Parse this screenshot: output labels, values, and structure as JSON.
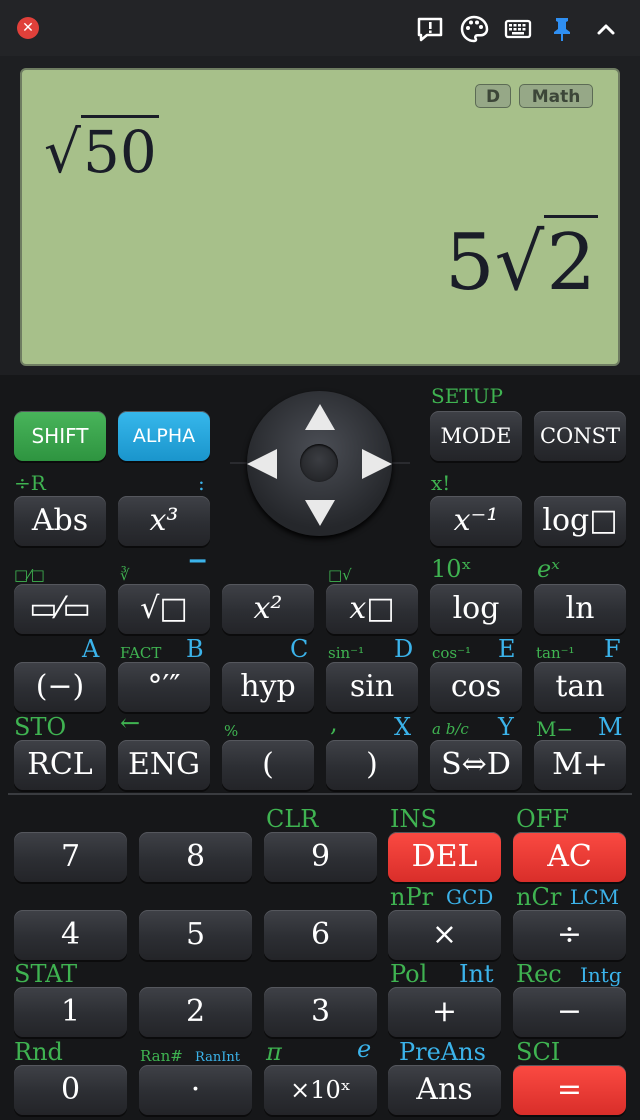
{
  "toolbar": {
    "icons": [
      "close-icon",
      "feedback-icon",
      "palette-icon",
      "keyboard-icon",
      "pin-icon",
      "chevron-up-icon"
    ],
    "close_glyph": "✕"
  },
  "display": {
    "badges": [
      "D",
      "Math"
    ],
    "expression": "50",
    "result_coef": "5",
    "result_rad": "2"
  },
  "keys": {
    "shift": "SHIFT",
    "alpha": "ALPHA",
    "mode": "MODE",
    "const": "CONST",
    "abs": "Abs",
    "x3": "x³",
    "xinv": "x⁻¹",
    "log_box": "log□",
    "frac": "▭⁄▭",
    "sqrt": "√□",
    "x2": "x²",
    "xpow": "x□",
    "log": "log",
    "ln": "ln",
    "neg": "(−)",
    "dms": "°′″",
    "hyp": "hyp",
    "sin": "sin",
    "cos": "cos",
    "tan": "tan",
    "rcl": "RCL",
    "eng": "ENG",
    "lparen": "(",
    "rparen": ")",
    "sd": "S⇔D",
    "mplus": "M+",
    "n7": "7",
    "n8": "8",
    "n9": "9",
    "del": "DEL",
    "ac": "AC",
    "n4": "4",
    "n5": "5",
    "n6": "6",
    "mul": "×",
    "div": "÷",
    "n1": "1",
    "n2": "2",
    "n3": "3",
    "plus": "+",
    "minus": "−",
    "n0": "0",
    "dot": "·",
    "exp": "×10ˣ",
    "ans": "Ans",
    "eq": "="
  },
  "labels": {
    "setup": "SETUP",
    "div_r": "÷R",
    "colon": ":",
    "fact_excl": "x!",
    "frac_alt": "□⁄□",
    "cbrt": "∛",
    "overline": "▔",
    "rootx": "□√",
    "ten_x": "10ˣ",
    "e_x": "eˣ",
    "a": "A",
    "fact": "FACT",
    "b": "B",
    "c": "C",
    "sin_inv": "sin⁻¹",
    "d": "D",
    "cos_inv": "cos⁻¹",
    "e_var": "E",
    "tan_inv": "tan⁻¹",
    "f": "F",
    "sto": "STO",
    "left_arrow": "←",
    "percent": "%",
    "comma": ",",
    "x_var": "X",
    "abc": "a b/c",
    "y_var": "Y",
    "m_minus": "M−",
    "m_var": "M",
    "clr": "CLR",
    "ins": "INS",
    "off": "OFF",
    "npr": "nPr",
    "gcd": "GCD",
    "ncr": "nCr",
    "lcm": "LCM",
    "stat": "STAT",
    "pol": "Pol",
    "int": "Int",
    "rec": "Rec",
    "intg": "Intg",
    "rnd": "Rnd",
    "ran": "Ran#",
    "ranint": "RanInt",
    "pi": "π",
    "e_const": "e",
    "preans": "PreAns",
    "sci": "SCI"
  }
}
